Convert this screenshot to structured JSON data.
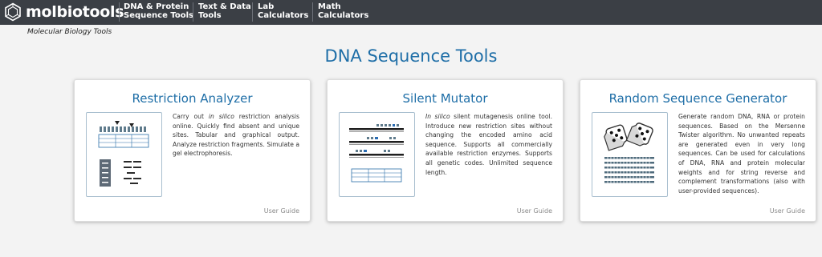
{
  "header": {
    "brand": "molbiotools",
    "tagline": "Molecular Biology Tools",
    "nav": [
      {
        "line1": "DNA & Protein",
        "line2": "Sequence Tools"
      },
      {
        "line1": "Text & Data",
        "line2": "Tools"
      },
      {
        "line1": "Lab",
        "line2": "Calculators"
      },
      {
        "line1": "Math",
        "line2": "Calculators"
      }
    ]
  },
  "page_title": "DNA Sequence Tools",
  "cards": [
    {
      "title": "Restriction Analyzer",
      "desc_parts": [
        "Carry out ",
        "in silico",
        " restriction analysis online. Quickly find absent and unique sites. Tabular and graphical output. Analyze restriction fragments. Simulate a gel electrophoresis."
      ],
      "guide": "User Guide",
      "icon": "restriction-analysis-icon"
    },
    {
      "title": "Silent Mutator",
      "desc_parts": [
        "In silico",
        " silent mutagenesis online tool. Introduce new restriction sites without changing the encoded amino acid sequence. Supports all commercially available restriction enzymes. Supports all genetic codes. Unlimited sequence length."
      ],
      "guide": "User Guide",
      "icon": "mutated-sequence-icon"
    },
    {
      "title": "Random Sequence Generator",
      "desc": "Generate random DNA, RNA or protein sequences. Based on the Mersenne Twister algorithm. No unwanted repeats are generated even in very long sequences. Can be used for calculations of DNA, RNA and protein molecular weights and for string reverse and complement transformations (also with user-provided sequences).",
      "guide": "User Guide",
      "icon": "dice-icon"
    }
  ],
  "colors": {
    "header_bg": "#3b3f45",
    "accent": "#1e6ea7",
    "page_bg": "#f3f3f3"
  }
}
